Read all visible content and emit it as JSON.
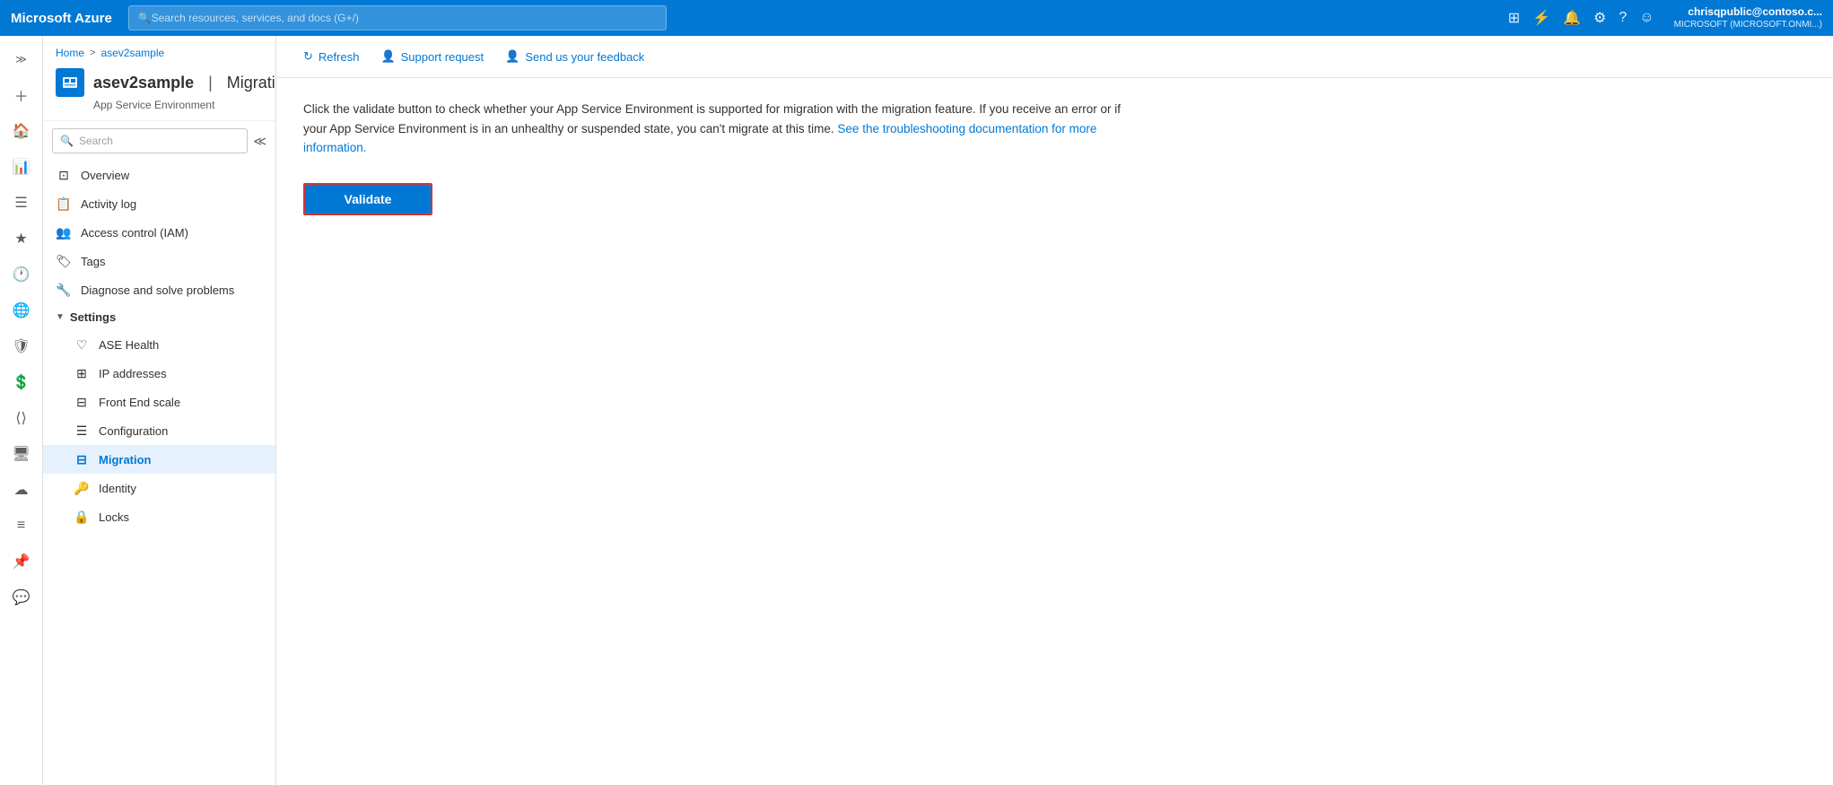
{
  "topbar": {
    "logo": "Microsoft Azure",
    "search_placeholder": "Search resources, services, and docs (G+/)",
    "user_name": "chrisqpublic@contoso.c...",
    "user_tenant": "MICROSOFT (MICROSOFT.ONMI...)",
    "icons": [
      "grid-icon",
      "feedback-icon",
      "bell-icon",
      "gear-icon",
      "help-icon",
      "person-icon"
    ]
  },
  "breadcrumb": {
    "home": "Home",
    "separator": ">",
    "resource": "asev2sample"
  },
  "resource": {
    "name": "asev2sample",
    "pipe": "|",
    "section": "Migration",
    "subtitle": "App Service Environment"
  },
  "nav": {
    "search_placeholder": "Search",
    "items": [
      {
        "id": "overview",
        "label": "Overview",
        "icon": "overview-icon"
      },
      {
        "id": "activity-log",
        "label": "Activity log",
        "icon": "activitylog-icon"
      },
      {
        "id": "access-control",
        "label": "Access control (IAM)",
        "icon": "iam-icon"
      },
      {
        "id": "tags",
        "label": "Tags",
        "icon": "tags-icon"
      },
      {
        "id": "diagnose",
        "label": "Diagnose and solve problems",
        "icon": "diagnose-icon"
      }
    ],
    "settings_label": "Settings",
    "settings_items": [
      {
        "id": "ase-health",
        "label": "ASE Health",
        "icon": "health-icon"
      },
      {
        "id": "ip-addresses",
        "label": "IP addresses",
        "icon": "ip-icon"
      },
      {
        "id": "front-end-scale",
        "label": "Front End scale",
        "icon": "scale-icon"
      },
      {
        "id": "configuration",
        "label": "Configuration",
        "icon": "config-icon"
      },
      {
        "id": "migration",
        "label": "Migration",
        "icon": "migration-icon",
        "active": true
      },
      {
        "id": "identity",
        "label": "Identity",
        "icon": "identity-icon"
      },
      {
        "id": "locks",
        "label": "Locks",
        "icon": "locks-icon"
      }
    ]
  },
  "toolbar": {
    "refresh_label": "Refresh",
    "support_label": "Support request",
    "feedback_label": "Send us your feedback"
  },
  "content": {
    "description": "Click the validate button to check whether your App Service Environment is supported for migration with the migration feature. If you receive an error or if your App Service Environment is in an unhealthy or suspended state, you can't migrate at this time.",
    "link_text": "See the troubleshooting documentation for more information.",
    "validate_label": "Validate"
  }
}
